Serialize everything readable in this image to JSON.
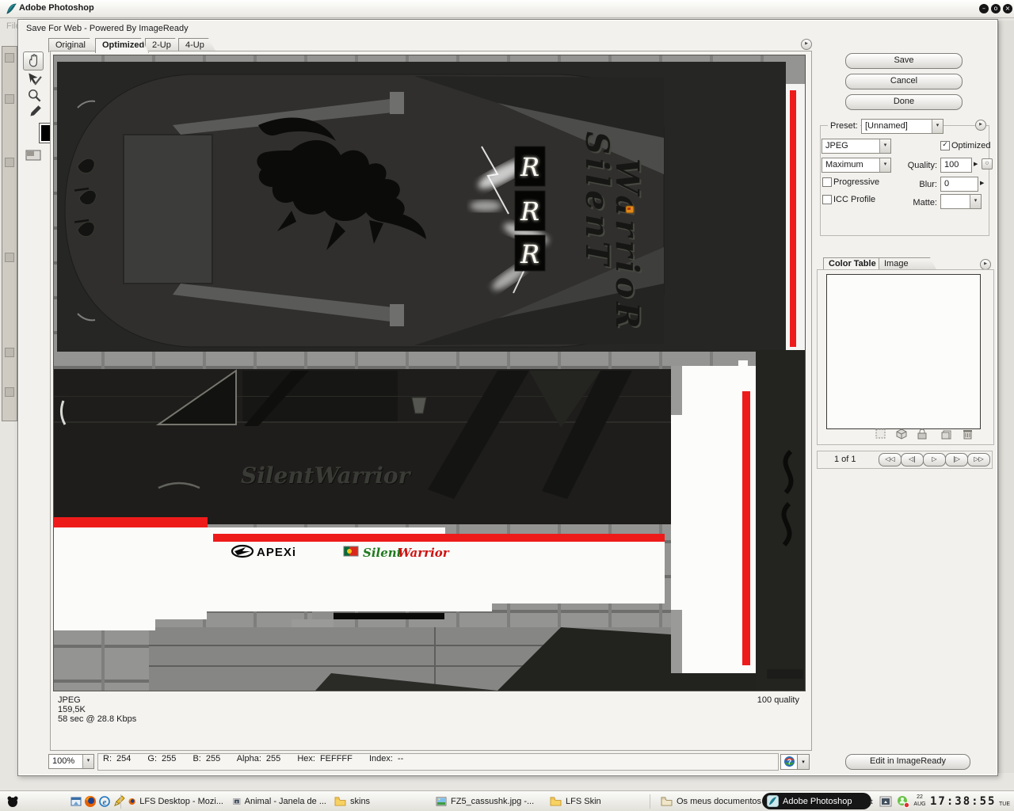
{
  "window": {
    "title": "Adobe Photoshop",
    "file_menu": "File",
    "controls": {
      "minimize": "–",
      "maximize": "o",
      "close": "×"
    }
  },
  "dialog": {
    "title": "Save For Web - Powered By ImageReady",
    "tabs": {
      "original": "Original",
      "optimized": "Optimized",
      "two_up": "2-Up",
      "four_up": "4-Up"
    },
    "stats": {
      "format": "JPEG",
      "size": "159,5K",
      "time": "58 sec @ 28.8 Kbps",
      "quality": "100 quality"
    },
    "zoom_level": "100%",
    "color_info": {
      "r_label": "R:",
      "r": "254",
      "g_label": "G:",
      "g": "255",
      "b_label": "B:",
      "b": "255",
      "alpha_label": "Alpha:",
      "alpha": "255",
      "hex_label": "Hex:",
      "hex": "FEFFFF",
      "index_label": "Index:",
      "index": "--"
    },
    "edit_in_imageready": "Edit in ImageReady",
    "panel": {
      "save": "Save",
      "cancel": "Cancel",
      "done": "Done",
      "preset_label": "Preset:",
      "preset_value": "[Unnamed]",
      "format": "JPEG",
      "optimized": "Optimized",
      "optimized_check": "✓",
      "compression": "Maximum",
      "quality_label": "Quality:",
      "quality_value": "100",
      "progressive": "Progressive",
      "blur_label": "Blur:",
      "blur_value": "0",
      "icc_profile": "ICC Profile",
      "matte_label": "Matte:",
      "color_table_tab": "Color Table",
      "image_size_tab": "Image Size",
      "pager_text": "1 of 1",
      "pager_buttons": {
        "first": "◁◁",
        "prev": "◁|",
        "play": "▷",
        "next": "|▷",
        "last": "▷▷"
      }
    },
    "skin": {
      "vertical_text_1": "SilenT",
      "vertical_text_2": "WarrioR",
      "side_text": "SilentWarrior",
      "brand": "APEXi",
      "logo_green": "Silent",
      "logo_red": "Warrior",
      "emblem_letter": "R"
    }
  },
  "taskbar": {
    "buttons": [
      {
        "label": "LFS Desktop - Mozi...",
        "icon": "firefox"
      },
      {
        "label": "Animal - Janela de ...",
        "icon": "app-window"
      },
      {
        "label": "skins",
        "icon": "folder"
      },
      {
        "label": "FZ5_cassushk.jpg -...",
        "icon": "image-file"
      },
      {
        "label": "LFS Skin",
        "icon": "folder"
      },
      {
        "label": "Os meus documentos",
        "icon": "folder"
      },
      {
        "label": "Adobe Photoshop",
        "icon": "photoshop",
        "active": true
      }
    ],
    "tray": {
      "collapse": "‹",
      "date_day": "22",
      "date_month": "AUG",
      "time": "17:38:55",
      "weekday": "TUE"
    }
  },
  "colors": {
    "accent_red": "#ee1b1b",
    "flag_green": "#046a38",
    "flag_red": "#da291c"
  }
}
